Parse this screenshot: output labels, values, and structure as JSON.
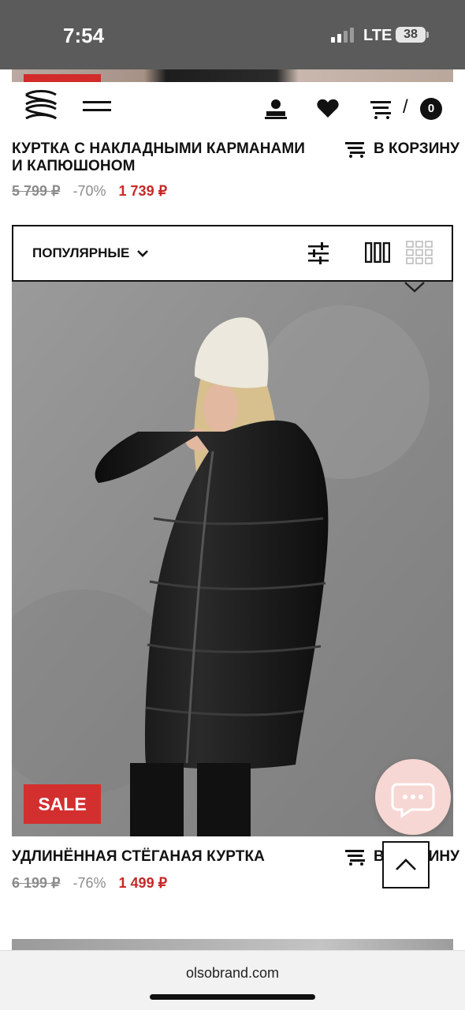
{
  "status_bar": {
    "time": "7:54",
    "network": "LTE",
    "battery": "38"
  },
  "header": {
    "slash": "/",
    "cart_count": "0"
  },
  "products": [
    {
      "title": "КУРТКА С НАКЛАДНЫМИ КАРМАНАМИ И КАПЮШОНОМ",
      "add_to_cart": "В КОРЗИНУ",
      "old_price": "5 799 ₽",
      "discount": "-70%",
      "price": "1 739 ₽"
    },
    {
      "title": "УДЛИНЁННАЯ СТЁГАНАЯ КУРТКА",
      "add_to_cart": "В КОРЗИНУ",
      "old_price": "6 199 ₽",
      "discount": "-76%",
      "price": "1 499 ₽",
      "badge": "SALE",
      "image_alt": "Woman in long black quilted puffer jacket and white knit hat"
    }
  ],
  "toolbar": {
    "sort_label": "ПОПУЛЯРНЫЕ"
  },
  "browser": {
    "url": "olsobrand.com"
  },
  "colors": {
    "sale_red": "#d32f2f",
    "price_red": "#c62828",
    "chat_bg": "#f7d7d3"
  },
  "icons": [
    "logo-icon",
    "menu-icon",
    "user-icon",
    "heart-icon",
    "cart-icon",
    "chevron-down-icon",
    "filter-icon",
    "grid-3-icon",
    "grid-9-icon",
    "chat-icon",
    "chevron-up-icon"
  ]
}
